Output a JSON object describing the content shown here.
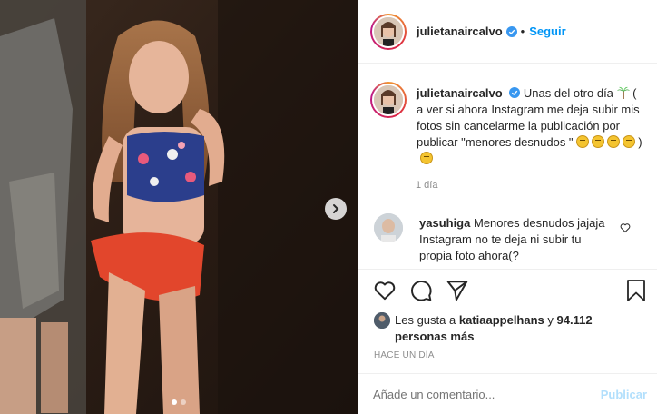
{
  "post": {
    "carousel": {
      "slide_count": 2,
      "active_slide": 1
    }
  },
  "header": {
    "username": "julietanaircalvo",
    "separator": "•",
    "follow_label": "Seguir"
  },
  "caption": {
    "username": "julietanaircalvo",
    "text_before_emoji": "Unas del otro día",
    "text_after_emoji": "( a ver si ahora Instagram me deja subir mis fotos sin cancelarme la publicación por publicar \"menores desnudos \"",
    "closing": ")",
    "time": "1 día"
  },
  "comment": {
    "username": "yasuhiga",
    "text": "Menores desnudos jajaja Instagram no te deja ni subir tu propia foto ahora(?"
  },
  "likes": {
    "prefix": "Les gusta a",
    "liker": "katiaappelhans",
    "conjunction": "y",
    "others": "94.112 personas más"
  },
  "date_label": "HACE UN DÍA",
  "add_comment": {
    "placeholder": "Añade un comentario...",
    "publish_label": "Publicar"
  },
  "colors": {
    "link_blue": "#0095f6",
    "publish_disabled": "#b2dffc",
    "muted": "#8e8e8e",
    "text": "#262626"
  }
}
